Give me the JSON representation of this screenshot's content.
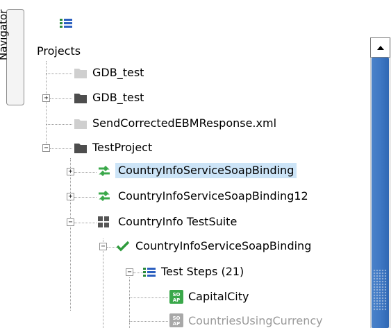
{
  "navigator": {
    "tab_label": "Navigator"
  },
  "toolbar": {
    "view_icon": "list-view-icon"
  },
  "tree": {
    "root_label": "Projects",
    "items": [
      {
        "label": "GDB_test",
        "icon": "closed-folder-icon-disabled",
        "expander": ""
      },
      {
        "label": "GDB_test",
        "icon": "closed-folder-icon",
        "expander": "+"
      },
      {
        "label": "SendCorrectedEBMResponse.xml",
        "icon": "closed-folder-icon-disabled",
        "expander": ""
      },
      {
        "label": "TestProject",
        "icon": "open-folder-icon",
        "expander": "−"
      },
      {
        "label": "CountryInfoServiceSoapBinding",
        "icon": "soap-binding-icon",
        "expander": "+",
        "selected": true
      },
      {
        "label": "CountryInfoServiceSoapBinding12",
        "icon": "soap-binding-icon",
        "expander": "+"
      },
      {
        "label": "CountryInfo TestSuite",
        "icon": "testsuite-grid-icon",
        "expander": "−"
      },
      {
        "label": "CountryInfoServiceSoapBinding",
        "icon": "checkmark-icon",
        "expander": "−"
      },
      {
        "label": "Test Steps (21)",
        "icon": "teststeps-list-icon",
        "expander": "−"
      },
      {
        "label": "CapitalCity",
        "icon": "soap-request-icon",
        "expander": ""
      },
      {
        "label": "CountriesUsingCurrency",
        "icon": "soap-request-icon-disabled",
        "expander": ""
      }
    ]
  },
  "colors": {
    "selection": "#cce4f7",
    "binding_green": "#3aa84a",
    "folder_dark": "#4d4d4d",
    "folder_light": "#cfcfcf",
    "scroll_thumb": "#3f78c4"
  }
}
